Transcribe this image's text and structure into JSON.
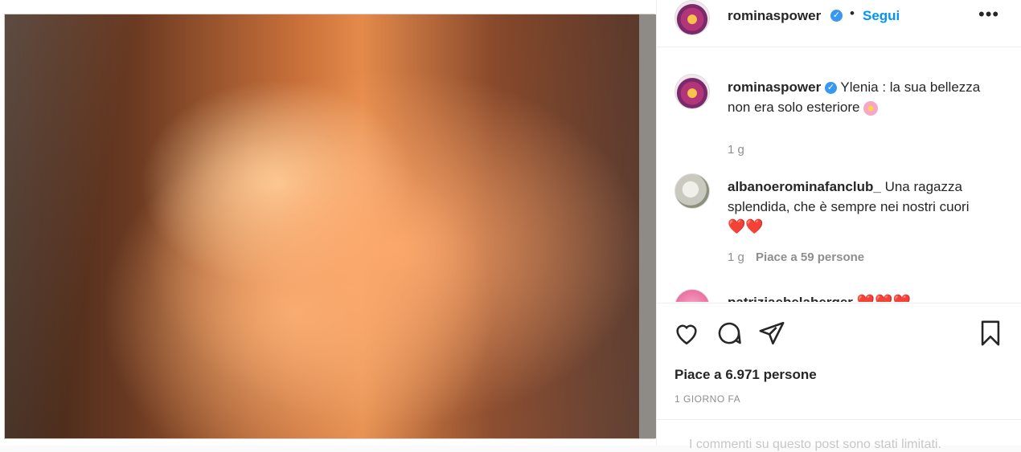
{
  "post": {
    "username": "rominaspower",
    "follow_label": "Segui",
    "separator": "•",
    "more": "•••"
  },
  "caption": {
    "username": "rominaspower",
    "text": "Ylenia : la sua bellezza non era solo esteriore",
    "time": "1 g"
  },
  "comments": [
    {
      "username": "albanoerominafanclub_",
      "text": "Una ragazza splendida, che è sempre nei nostri cuori",
      "emoji": "❤️❤️",
      "time": "1 g",
      "likes": "Piace a 59 persone"
    },
    {
      "username": "patriziaebelaberger",
      "emoji": "❤️❤️❤️"
    }
  ],
  "actions": {
    "like_icon": "heart-icon",
    "comment_icon": "comment-icon",
    "share_icon": "share-icon",
    "save_icon": "bookmark-icon"
  },
  "likes_total": "Piace a 6.971 persone",
  "timestamp": "1 GIORNO FA",
  "footer_text": "I commenti su questo post sono stati limitati.",
  "colors": {
    "accent": "#0095f6",
    "verified": "#3897f0"
  }
}
